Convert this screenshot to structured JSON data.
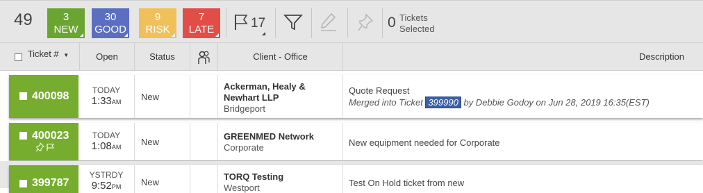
{
  "toolbar": {
    "total": "49",
    "pills": [
      {
        "num": "3",
        "label": "NEW",
        "color": "#6aa532"
      },
      {
        "num": "30",
        "label": "GOOD",
        "color": "#5b6ec0"
      },
      {
        "num": "9",
        "label": "RISK",
        "color": "#f0c05a"
      },
      {
        "num": "7",
        "label": "LATE",
        "color": "#e04e47"
      }
    ],
    "flag_count": "17",
    "selected_count": "0",
    "selected_label_1": "Tickets",
    "selected_label_2": "Selected",
    "icons": [
      "flag-icon",
      "filter-icon",
      "edit-icon",
      "pin-icon"
    ]
  },
  "header": {
    "ticket": "Ticket #",
    "open": "Open",
    "status": "Status",
    "client": "Client  -  Office",
    "description": "Description",
    "tech_icon": "technician-icon"
  },
  "rows": [
    {
      "ticket": "400098",
      "open_day": "TODAY",
      "open_time": "1:33",
      "open_ampm": "AM",
      "status": "New",
      "client": "Ackerman, Healy & Newhart LLP",
      "office": "Bridgeport",
      "desc": "Quote Request",
      "merged_prefix": "Merged into Ticket",
      "merged_ticket": "399990",
      "merged_suffix": "by Debbie Godoy on Jun 28, 2019 16:35(EST)"
    },
    {
      "ticket": "400023",
      "open_day": "TODAY",
      "open_time": "1:08",
      "open_ampm": "AM",
      "status": "New",
      "client": "GREENMED Network",
      "office": "Corporate",
      "desc": "New equipment needed for Corporate",
      "icons": [
        "pin-icon",
        "flag-icon"
      ]
    },
    {
      "ticket": "399787",
      "open_day": "YSTRDY",
      "open_time": "9:52",
      "open_ampm": "PM",
      "status": "New",
      "client": "TORQ Testing",
      "office": "Westport",
      "desc": "Test On Hold ticket from new"
    }
  ]
}
